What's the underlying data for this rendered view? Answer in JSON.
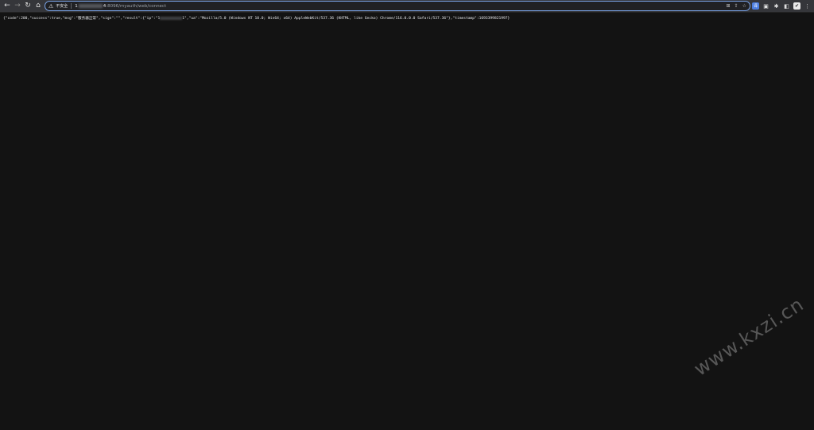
{
  "toolbar": {
    "back_icon": "back-arrow-icon",
    "forward_icon": "forward-arrow-icon",
    "reload_icon": "reload-icon",
    "home_icon": "home-icon"
  },
  "omnibox": {
    "security_label": "不安全",
    "url_host_prefix": "1",
    "url_host_suffix": "4",
    "url_port_path": ":8096/myauth/web/connect"
  },
  "page": {
    "json_before_ip": "{\"code\":200,\"success\":true,\"msg\":\"服务器正常\",\"sign\":\"\",\"result\":{\"ip\":\"1",
    "json_after_ip": "1\",\"ua\":\"Mozilla/5.0 (Windows NT 10.0; Win64; x64) AppleWebKit/537.36 (KHTML, like Gecko) Chrome/116.0.0.0 Safari/537.36\"},\"timestamp\":1693399821997}"
  },
  "watermark": {
    "text": "www.kxzi.cn"
  },
  "colors": {
    "page_background": "#131313",
    "toolbar_background": "#35363a",
    "omnibox_border": "#7aa4e8"
  }
}
